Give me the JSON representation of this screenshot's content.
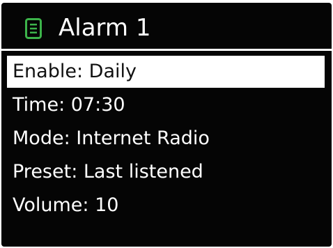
{
  "header": {
    "title": "Alarm 1",
    "icon": "list-icon",
    "icon_color": "#3cb34a"
  },
  "colors": {
    "screen_background": "#050505",
    "text": "#ffffff",
    "selection_background": "#ffffff",
    "selection_text": "#111111"
  },
  "menu": {
    "items": [
      {
        "label": "Enable: Daily",
        "selected": true
      },
      {
        "label": "Time: 07:30",
        "selected": false
      },
      {
        "label": "Mode: Internet Radio",
        "selected": false
      },
      {
        "label": "Preset: Last listened",
        "selected": false
      },
      {
        "label": "Volume: 10",
        "selected": false
      }
    ]
  }
}
